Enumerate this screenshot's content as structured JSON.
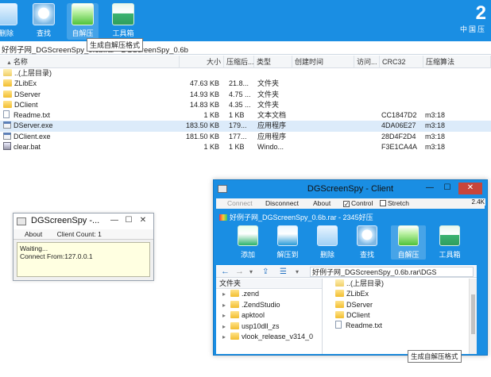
{
  "toolbar": {
    "delete_label": "删除",
    "find_label": "查找",
    "sfx_label": "自解压",
    "tools_label": "工具箱",
    "brand_big": "2",
    "brand_small": "中国压",
    "tooltip": "生成自解压格式"
  },
  "path": "好例子网_DGScreenSpy_0.6b.rar - DGScreenSpy_0.6b",
  "columns": [
    "名称",
    "大小",
    "压缩后...",
    "类型",
    "创建时间",
    "访问...",
    "CRC32",
    "压缩算法"
  ],
  "files": [
    {
      "name": "..(上层目录)",
      "size": "",
      "packed": "",
      "type": "",
      "crc": "",
      "algo": "",
      "icon": "folder-up-icon"
    },
    {
      "name": "ZLibEx",
      "size": "47.63 KB",
      "packed": "21.8...",
      "type": "文件夹",
      "crc": "",
      "algo": "",
      "icon": "folder-icon"
    },
    {
      "name": "DServer",
      "size": "14.93 KB",
      "packed": "4.75 ...",
      "type": "文件夹",
      "crc": "",
      "algo": "",
      "icon": "folder-icon"
    },
    {
      "name": "DClient",
      "size": "14.83 KB",
      "packed": "4.35 ...",
      "type": "文件夹",
      "crc": "",
      "algo": "",
      "icon": "folder-icon"
    },
    {
      "name": "Readme.txt",
      "size": "1 KB",
      "packed": "1 KB",
      "type": "文本文档",
      "crc": "CC1847D2",
      "algo": "m3:18",
      "icon": "text-file-icon"
    },
    {
      "name": "DServer.exe",
      "size": "183.50 KB",
      "packed": "179...",
      "type": "应用程序",
      "crc": "4DA06E27",
      "algo": "m3:18",
      "icon": "exe-file-icon"
    },
    {
      "name": "DClient.exe",
      "size": "181.50 KB",
      "packed": "177...",
      "type": "应用程序",
      "crc": "28D4F2D4",
      "algo": "m3:18",
      "icon": "exe-file-icon"
    },
    {
      "name": "clear.bat",
      "size": "1 KB",
      "packed": "1 KB",
      "type": "Windo...",
      "crc": "F3E1CA4A",
      "algo": "m3:18",
      "icon": "bat-file-icon"
    }
  ],
  "server_window": {
    "title": "DGScreenSpy -...",
    "menu_about": "About",
    "client_count": "Client Count: 1",
    "log_line1": "Waiting...",
    "log_line2": "Connect From:127.0.0.1"
  },
  "client_window": {
    "title": "DGScreenSpy - Client",
    "connect": "Connect",
    "disconnect": "Disconnect",
    "about": "About",
    "control": "Control",
    "control_checked": "✓",
    "stretch": "Stretch",
    "side_value": "2.4K",
    "remote_title": "好例子网_DGScreenSpy_0.6b.rar - 2345好压",
    "remote_buttons": [
      "添加",
      "解压到",
      "删除",
      "查找",
      "自解压",
      "工具箱"
    ],
    "remote_path": "好例子网_DGScreenSpy_0.6b.rar\\DGS",
    "tree_header": "文件夹",
    "tree_items": [
      ".zend",
      ".ZendStudio",
      "apktool",
      "usp10dll_zs",
      "vlook_release_v314_0"
    ],
    "list_items": [
      "..(上层目录)",
      "ZLibEx",
      "DServer",
      "DClient",
      "Readme.txt"
    ],
    "tooltip": "生成自解压格式"
  },
  "colors": {
    "toolbar_blue": "#1a8ee3",
    "selection": "#dcebfa",
    "log_bg": "#ffffe1"
  }
}
